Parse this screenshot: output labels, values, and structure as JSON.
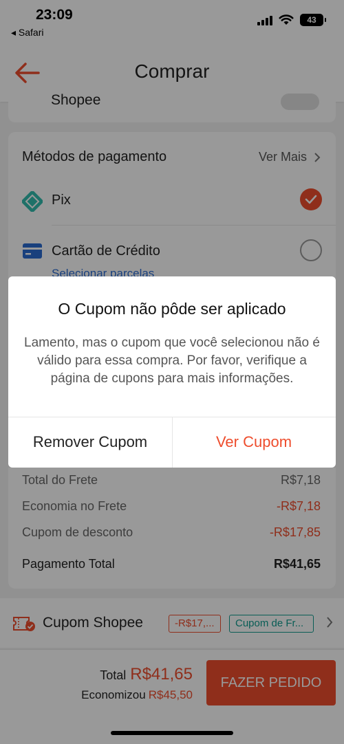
{
  "status_bar": {
    "time": "23:09",
    "back_app": "◂ Safari",
    "battery": "43"
  },
  "header": {
    "title": "Comprar"
  },
  "partial_row": {
    "label": "Shopee"
  },
  "payment": {
    "title": "Métodos de pagamento",
    "see_more": "Ver Mais",
    "options": [
      {
        "label": "Pix",
        "selected": true
      },
      {
        "label": "Cartão de Crédito",
        "selected": false
      }
    ],
    "installments_link": "Selecionar parcelas"
  },
  "totals": {
    "rows": [
      {
        "label": "Total do Frete",
        "value": "R$7,18"
      },
      {
        "label": "Economia no Frete",
        "value": "-R$7,18"
      },
      {
        "label": "Cupom de desconto",
        "value": "-R$17,85"
      },
      {
        "label": "Pagamento Total",
        "value": "R$41,65"
      }
    ]
  },
  "coupon": {
    "label": "Cupom Shopee",
    "chip_discount": "-R$17,...",
    "chip_shipping": "Cupom de Fr..."
  },
  "footer": {
    "total_label": "Total",
    "total_value": "R$41,65",
    "saved_label": "Economizou",
    "saved_value": "R$45,50",
    "order_button": "FAZER PEDIDO"
  },
  "dialog": {
    "title": "O Cupom não pôde ser aplicado",
    "message": "Lamento, mas o cupom que você selecionou não é válido para essa compra. Por favor, verifique a página de cupons para mais informações.",
    "remove_button": "Remover Cupom",
    "view_button": "Ver Cupom"
  },
  "colors": {
    "accent": "#ee4d2d",
    "pix": "#32bcad",
    "card_blue": "#2a6bd1",
    "shipping_green": "#0f9b8e"
  }
}
